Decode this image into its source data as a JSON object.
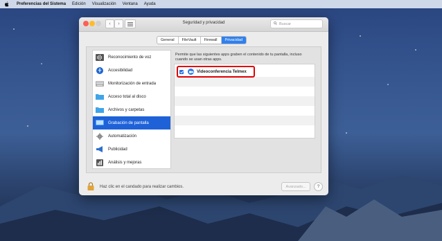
{
  "menubar": {
    "apple_icon": "apple-icon",
    "app_name": "Preferencias del Sistema",
    "items": [
      "Edición",
      "Visualización",
      "Ventana",
      "Ayuda"
    ]
  },
  "window": {
    "title": "Seguridad y privacidad",
    "search_placeholder": "Buscar",
    "tabs": [
      {
        "label": "General",
        "active": false
      },
      {
        "label": "FileVault",
        "active": false
      },
      {
        "label": "Firewall",
        "active": false
      },
      {
        "label": "Privacidad",
        "active": true
      }
    ],
    "sidebar": [
      {
        "label": "Reconocimiento de voz",
        "icon": "voice-recognition-icon",
        "selected": false
      },
      {
        "label": "Accesibilidad",
        "icon": "accessibility-icon",
        "selected": false
      },
      {
        "label": "Monitorización de entrada",
        "icon": "keyboard-icon",
        "selected": false
      },
      {
        "label": "Acceso total al disco",
        "icon": "folder-icon",
        "selected": false
      },
      {
        "label": "Archivos y carpetas",
        "icon": "folder-icon",
        "selected": false
      },
      {
        "label": "Grabación de pantalla",
        "icon": "screen-recording-icon",
        "selected": true
      },
      {
        "label": "Automatización",
        "icon": "gear-icon",
        "selected": false
      },
      {
        "label": "Publicidad",
        "icon": "megaphone-icon",
        "selected": false
      },
      {
        "label": "Análisis y mejoras",
        "icon": "analytics-icon",
        "selected": false
      }
    ],
    "permission_text": "Permite que las siguientes apps graben el contenido de tu pantalla, incluso cuando se usan otras apps.",
    "apps": [
      {
        "name": "Videoconferencia Telmex",
        "checked": true,
        "icon": "video-camera-icon"
      }
    ],
    "lock_text": "Haz clic en el candado para realizar cambios.",
    "advanced_button": "Avanzado...",
    "help_button": "?"
  },
  "colors": {
    "accent": "#2f80f0",
    "selected_row": "#1f62d8",
    "highlight_border": "#e00000"
  }
}
